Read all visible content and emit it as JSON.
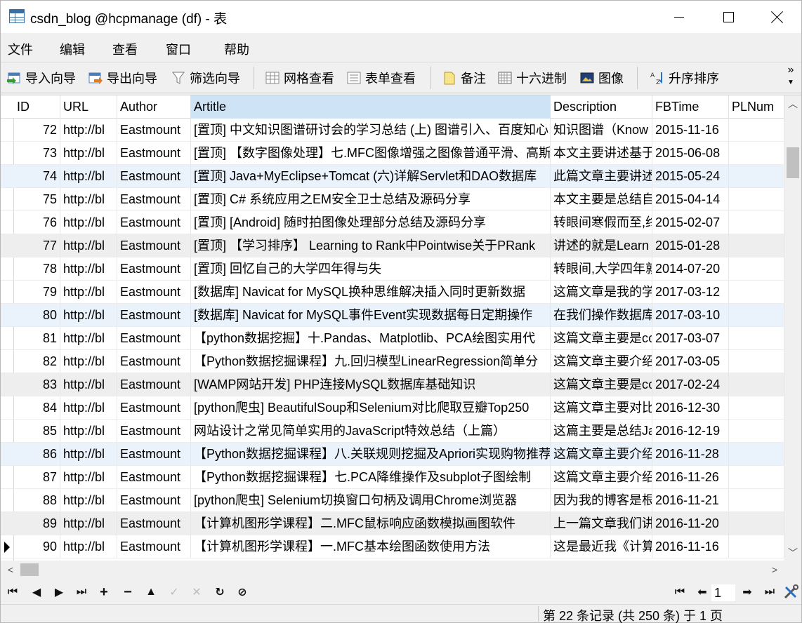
{
  "window": {
    "title": "csdn_blog @hcpmanage (df) - 表",
    "minimize_icon": "minimize-icon",
    "maximize_icon": "maximize-icon",
    "close_icon": "close-icon"
  },
  "menu": [
    "文件",
    "编辑",
    "查看",
    "窗口",
    "帮助"
  ],
  "toolbar": {
    "import_wizard": "导入向导",
    "export_wizard": "导出向导",
    "filter_wizard": "筛选向导",
    "grid_view": "网格查看",
    "form_view": "表单查看",
    "memo": "备注",
    "hex": "十六进制",
    "image": "图像",
    "sort_asc": "升序排序",
    "more_glyph": "»"
  },
  "grid": {
    "columns": [
      "ID",
      "URL",
      "Author",
      "Artitle",
      "Description",
      "FBTime",
      "PLNum"
    ],
    "active_column": "Artitle",
    "rows": [
      [
        "72",
        "http://bl",
        "Eastmount",
        "[置顶] 中文知识图谱研讨会的学习总结 (上) 图谱引入、百度知心",
        "知识图谱（Know",
        "2015-11-16"
      ],
      [
        "73",
        "http://bl",
        "Eastmount",
        "[置顶] 【数字图像处理】七.MFC图像增强之图像普通平滑、高斯",
        "本文主要讲述基于",
        "2015-06-08"
      ],
      [
        "74",
        "http://bl",
        "Eastmount",
        "[置顶] Java+MyEclipse+Tomcat (六)详解Servlet和DAO数据库",
        "此篇文章主要讲述",
        "2015-05-24"
      ],
      [
        "75",
        "http://bl",
        "Eastmount",
        "[置顶] C# 系统应用之EM安全卫士总结及源码分享",
        "本文主要是总结自",
        "2015-04-14"
      ],
      [
        "76",
        "http://bl",
        "Eastmount",
        "[置顶] [Android] 随时拍图像处理部分总结及源码分享",
        "转眼间寒假而至,终",
        "2015-02-07"
      ],
      [
        "77",
        "http://bl",
        "Eastmount",
        "[置顶] 【学习排序】 Learning to Rank中Pointwise关于PRank",
        "讲述的就是Learn",
        "2015-01-28"
      ],
      [
        "78",
        "http://bl",
        "Eastmount",
        "[置顶] 回忆自己的大学四年得与失",
        "转眼间,大学四年就",
        "2014-07-20"
      ],
      [
        "79",
        "http://bl",
        "Eastmount",
        "[数据库] Navicat for MySQL换种思维解决插入同时更新数据",
        "这篇文章是我的学",
        "2017-03-12"
      ],
      [
        "80",
        "http://bl",
        "Eastmount",
        "[数据库] Navicat for MySQL事件Event实现数据每日定期操作",
        "在我们操作数据库",
        "2017-03-10"
      ],
      [
        "81",
        "http://bl",
        "Eastmount",
        "【python数据挖掘】十.Pandas、Matplotlib、PCA绘图实用代",
        "这篇文章主要是со",
        "2017-03-07"
      ],
      [
        "82",
        "http://bl",
        "Eastmount",
        "【Python数据挖掘课程】九.回归模型LinearRegression简单分",
        "这篇文章主要介绍",
        "2017-03-05"
      ],
      [
        "83",
        "http://bl",
        "Eastmount",
        "[WAMP网站开发] PHP连接MySQL数据库基础知识",
        "这篇文章主要是со",
        "2017-02-24"
      ],
      [
        "84",
        "http://bl",
        "Eastmount",
        "[python爬虫] BeautifulSoup和Selenium对比爬取豆瓣Top250",
        "这篇文章主要对比",
        "2016-12-30"
      ],
      [
        "85",
        "http://bl",
        "Eastmount",
        "网站设计之常见简单实用的JavaScript特效总结（上篇）",
        "这篇主要是总结Ja",
        "2016-12-19"
      ],
      [
        "86",
        "http://bl",
        "Eastmount",
        "【Python数据挖掘课程】八.关联规则挖掘及Apriori实现购物推荐",
        "这篇文章主要介绍",
        "2016-11-28"
      ],
      [
        "87",
        "http://bl",
        "Eastmount",
        "【Python数据挖掘课程】七.PCA降维操作及subplot子图绘制",
        "这篇文章主要介绍",
        "2016-11-26"
      ],
      [
        "88",
        "http://bl",
        "Eastmount",
        "[python爬虫] Selenium切换窗口句柄及调用Chrome浏览器",
        "因为我的博客是根",
        "2016-11-21"
      ],
      [
        "89",
        "http://bl",
        "Eastmount",
        "【计算机图形学课程】二.MFC鼠标响应函数模拟画图软件",
        "上一篇文章我们讲",
        "2016-11-20"
      ],
      [
        "90",
        "http://bl",
        "Eastmount",
        "【计算机图形学课程】一.MFC基本绘图函数使用方法",
        "这是最近我《计算",
        "2016-11-16"
      ]
    ]
  },
  "nav": {
    "page_value": "1"
  },
  "status": {
    "text": "第 22 条记录 (共 250 条) 于 1 页"
  },
  "colors": {
    "active_header": "#cfe3f7",
    "selected_row": "#eaf2fb",
    "alt_row": "#eeeeee"
  }
}
